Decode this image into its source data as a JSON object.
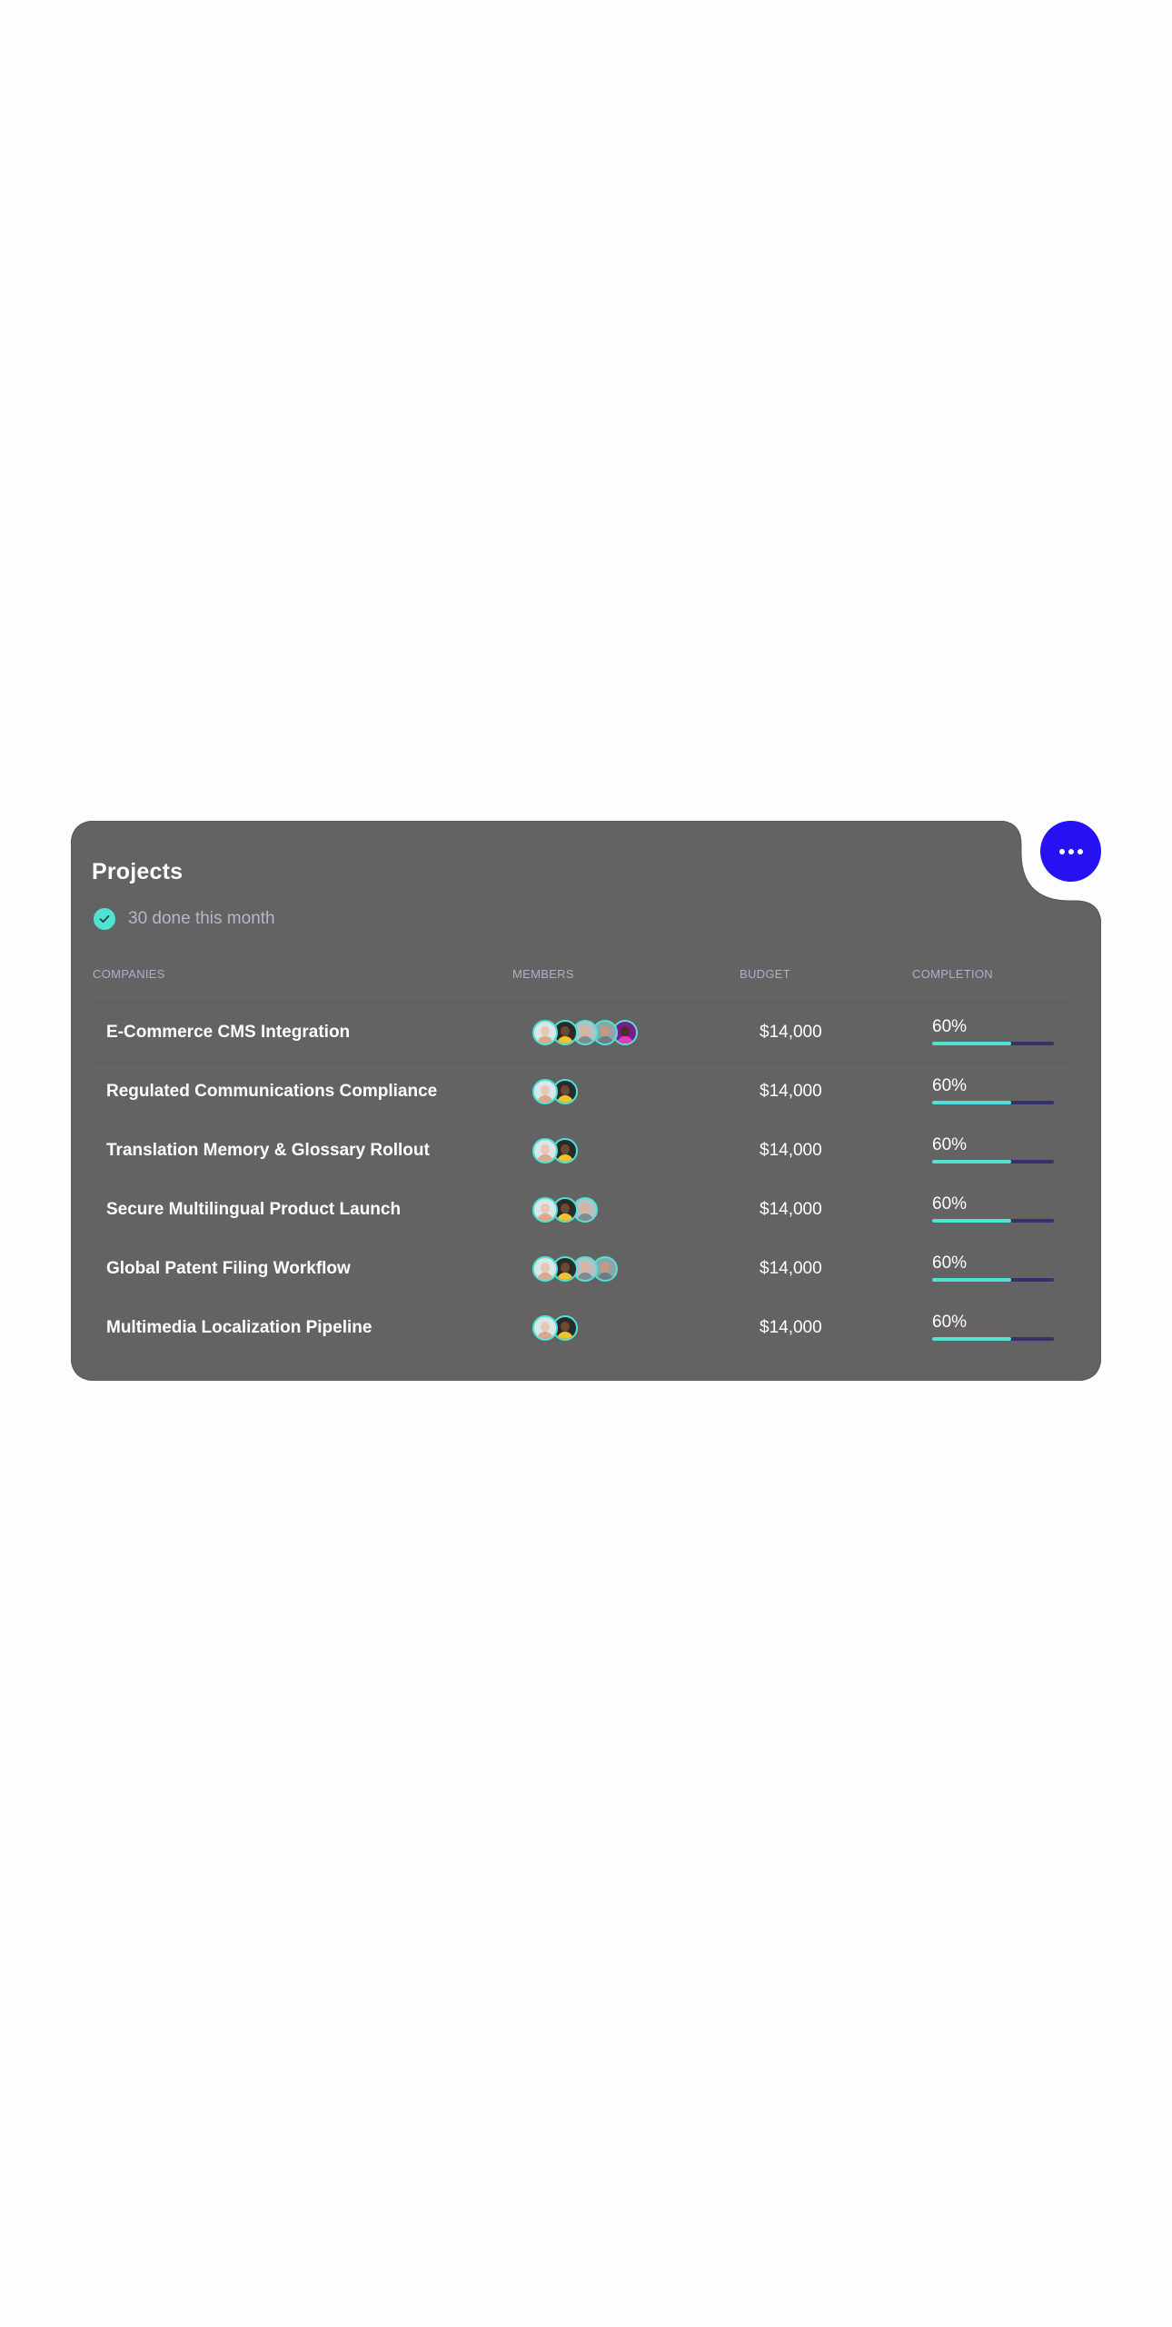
{
  "card": {
    "title": "Projects",
    "summary": "30 done this month",
    "background": "#636363",
    "accent": "#4ee3d2",
    "track": "#33336a",
    "more_button_color": "#2511f2",
    "more_icon": "ellipsis-icon",
    "check_icon": "check-circle-icon"
  },
  "table": {
    "columns": {
      "companies": "COMPANIES",
      "members": "MEMBERS",
      "budget": "BUDGET",
      "completion": "COMPLETION"
    },
    "rows": [
      {
        "name": "E-Commerce CMS Integration",
        "members": 5,
        "budget": "$14,000",
        "completion_label": "60%",
        "completion": 0.65
      },
      {
        "name": "Regulated Communications Compliance",
        "members": 2,
        "budget": "$14,000",
        "completion_label": "60%",
        "completion": 0.65
      },
      {
        "name": "Translation Memory & Glossary Rollout",
        "members": 2,
        "budget": "$14,000",
        "completion_label": "60%",
        "completion": 0.65
      },
      {
        "name": "Secure Multilingual Product Launch",
        "members": 3,
        "budget": "$14,000",
        "completion_label": "60%",
        "completion": 0.65
      },
      {
        "name": "Global Patent Filing Workflow",
        "members": 4,
        "budget": "$14,000",
        "completion_label": "60%",
        "completion": 0.65
      },
      {
        "name": "Multimedia Localization Pipeline",
        "members": 2,
        "budget": "$14,000",
        "completion_label": "60%",
        "completion": 0.65
      }
    ]
  },
  "avatars": [
    {
      "face": "#e9c7b5",
      "body": "#d9a98e",
      "bg": "#d9e6ea"
    },
    {
      "face": "#6b4a32",
      "body": "#f2c230",
      "bg": "#2a2a2a"
    },
    {
      "face": "#d8b49a",
      "body": "#7f8a92",
      "bg": "#b7c1c5"
    },
    {
      "face": "#c79a7b",
      "body": "#6e7c86",
      "bg": "#8fa5ab"
    },
    {
      "face": "#4a2f25",
      "body": "#e43bb5",
      "bg": "#7b1a8e"
    }
  ]
}
